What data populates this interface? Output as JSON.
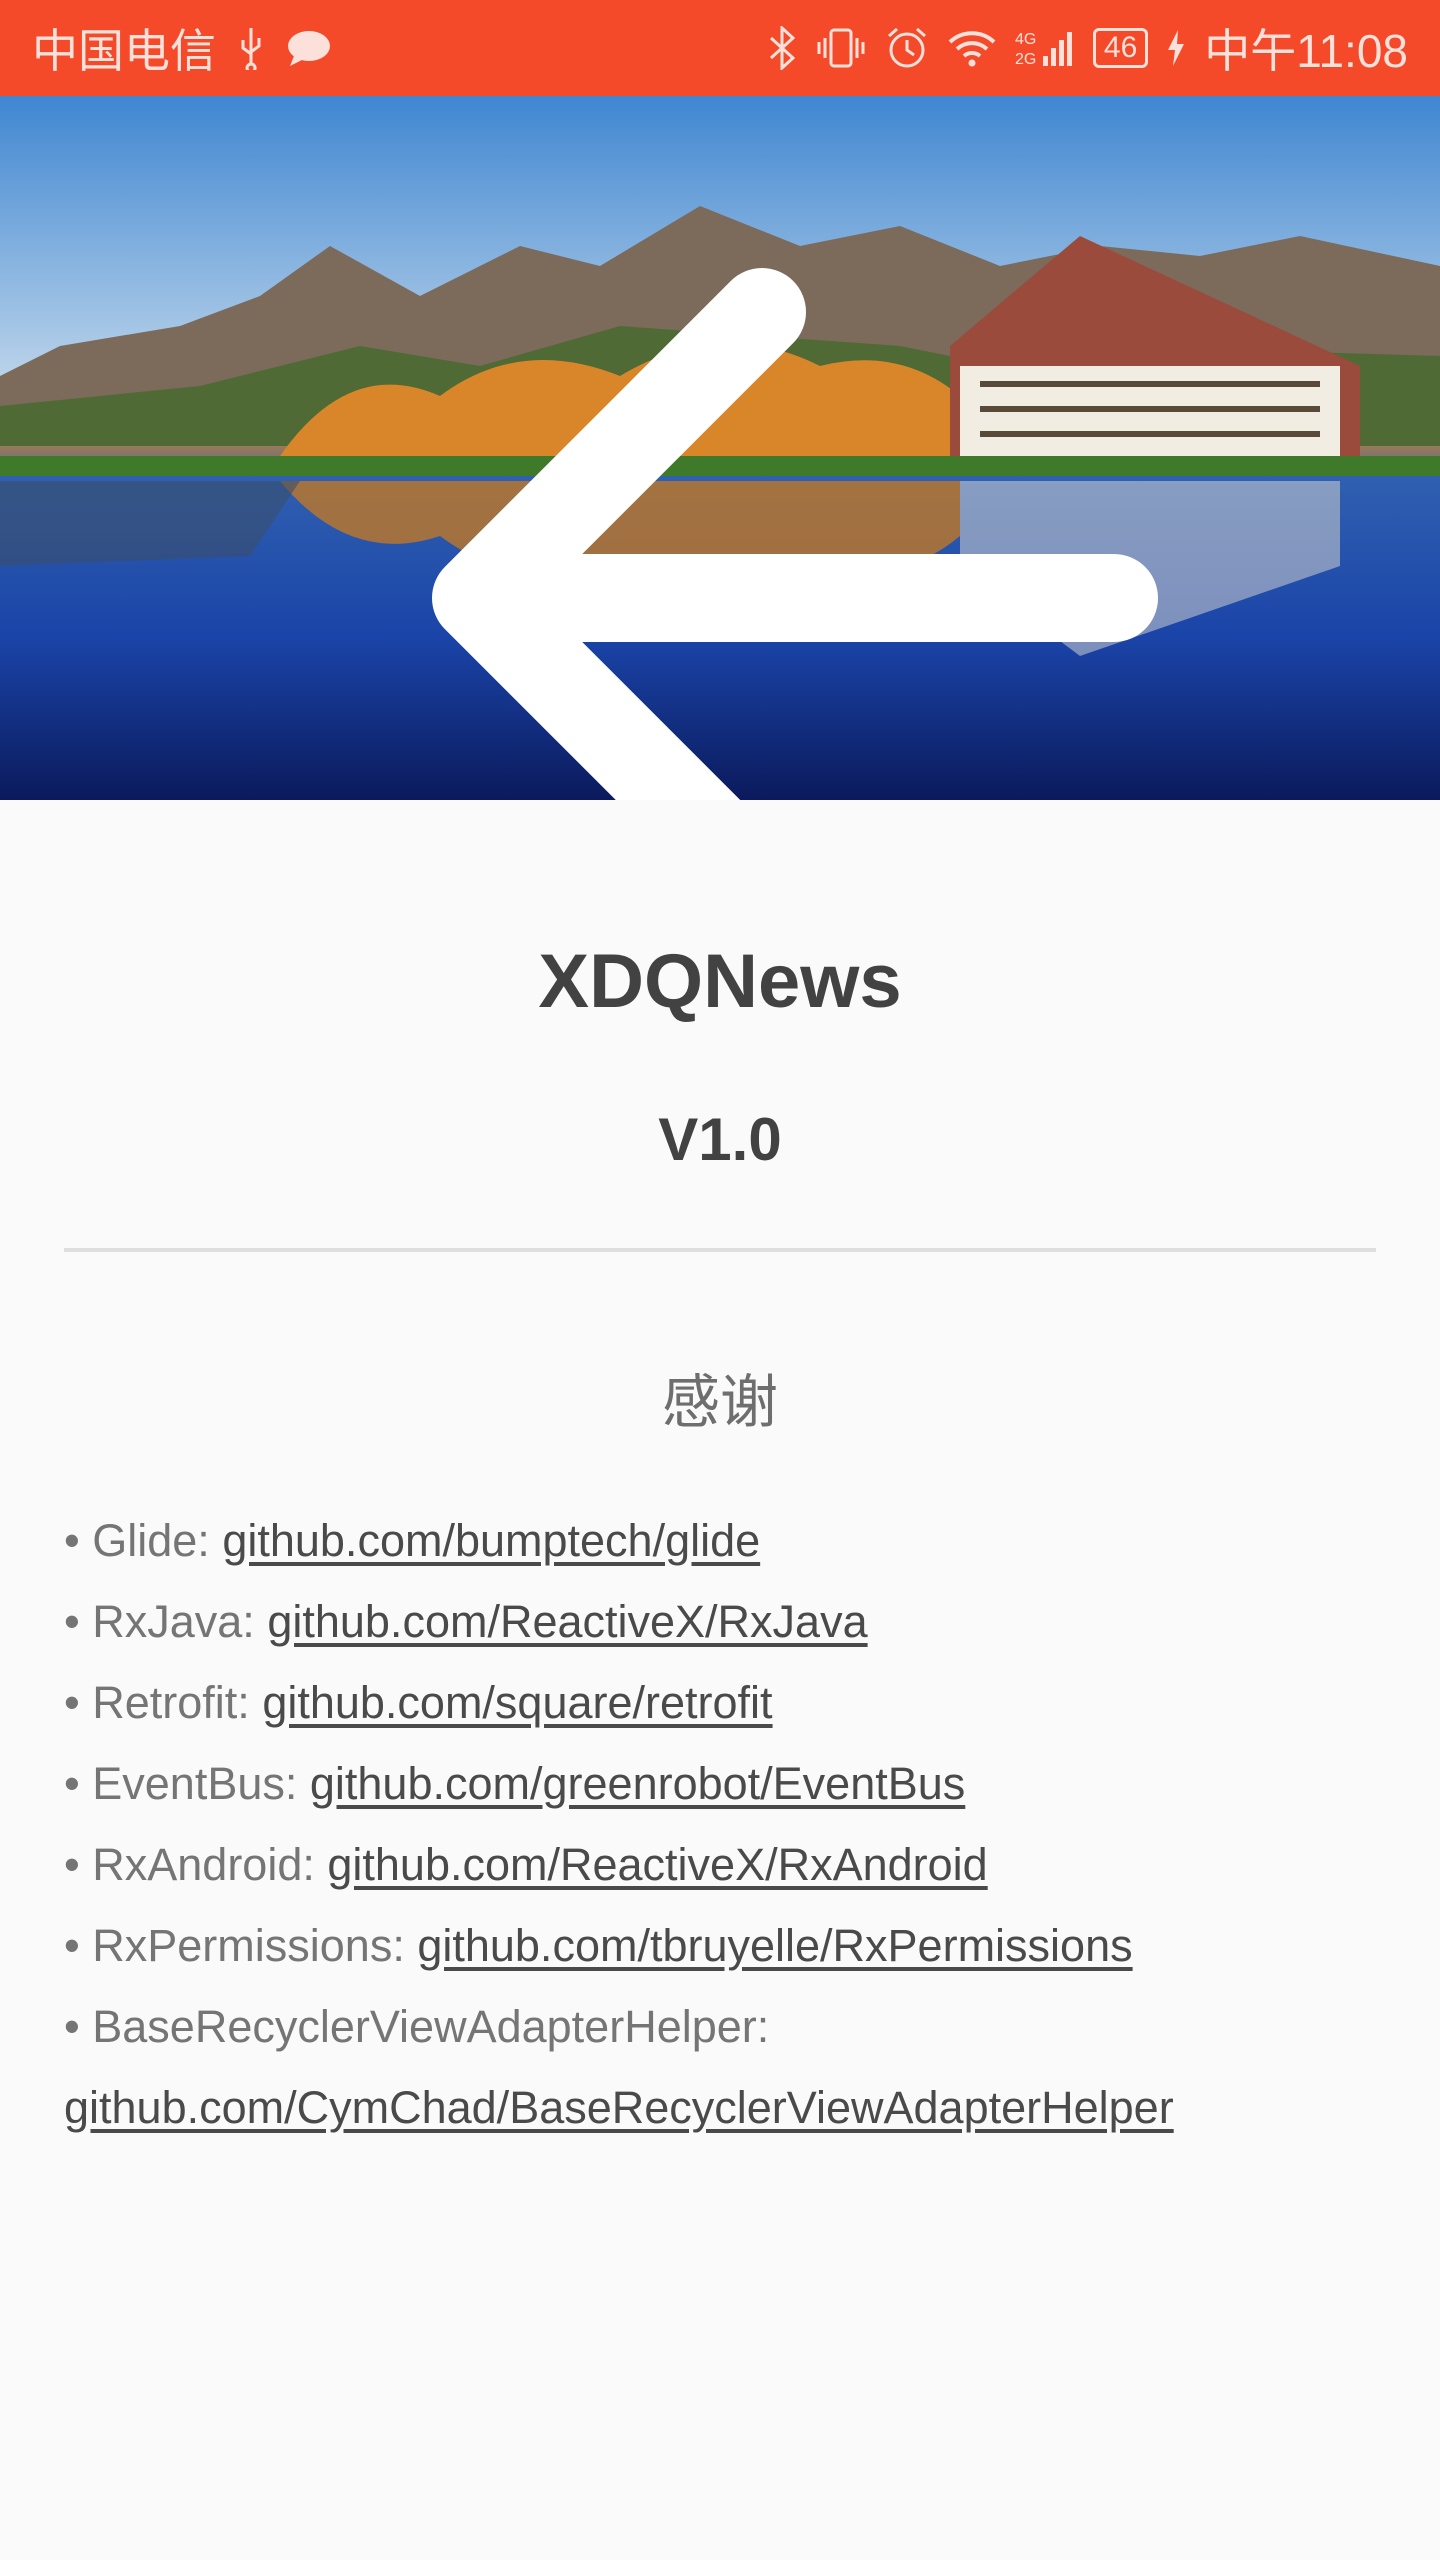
{
  "status_bar": {
    "carrier": "中国电信",
    "battery": "46",
    "time": "中午11:08",
    "icons": [
      "usb-icon",
      "chat-icon",
      "bluetooth-icon",
      "vibrate-icon",
      "alarm-icon",
      "wifi-icon",
      "signal-icon",
      "charging-icon"
    ]
  },
  "header": {
    "back_icon": "arrow-left-icon"
  },
  "about": {
    "app_name": "XDQNews",
    "version": "V1.0",
    "thanks_title": "感谢"
  },
  "credits": [
    {
      "label": "• Glide: ",
      "link": "github.com/bumptech/glide"
    },
    {
      "label": "• RxJava: ",
      "link": "github.com/ReactiveX/RxJava"
    },
    {
      "label": "• Retrofit: ",
      "link": "github.com/square/retrofit"
    },
    {
      "label": "• EventBus: ",
      "link": "github.com/greenrobot/EventBus"
    },
    {
      "label": "• RxAndroid: ",
      "link": "github.com/ReactiveX/RxAndroid"
    },
    {
      "label": "• RxPermissions: ",
      "link": "github.com/tbruyelle/RxPermissions"
    },
    {
      "label": "• BaseRecyclerViewAdapterHelper: ",
      "link": "github.com/CymChad/BaseRecyclerViewAdapterHelper"
    }
  ],
  "colors": {
    "status_bar": "#f44a2a",
    "background": "#fafafa",
    "text_primary": "#424242"
  }
}
